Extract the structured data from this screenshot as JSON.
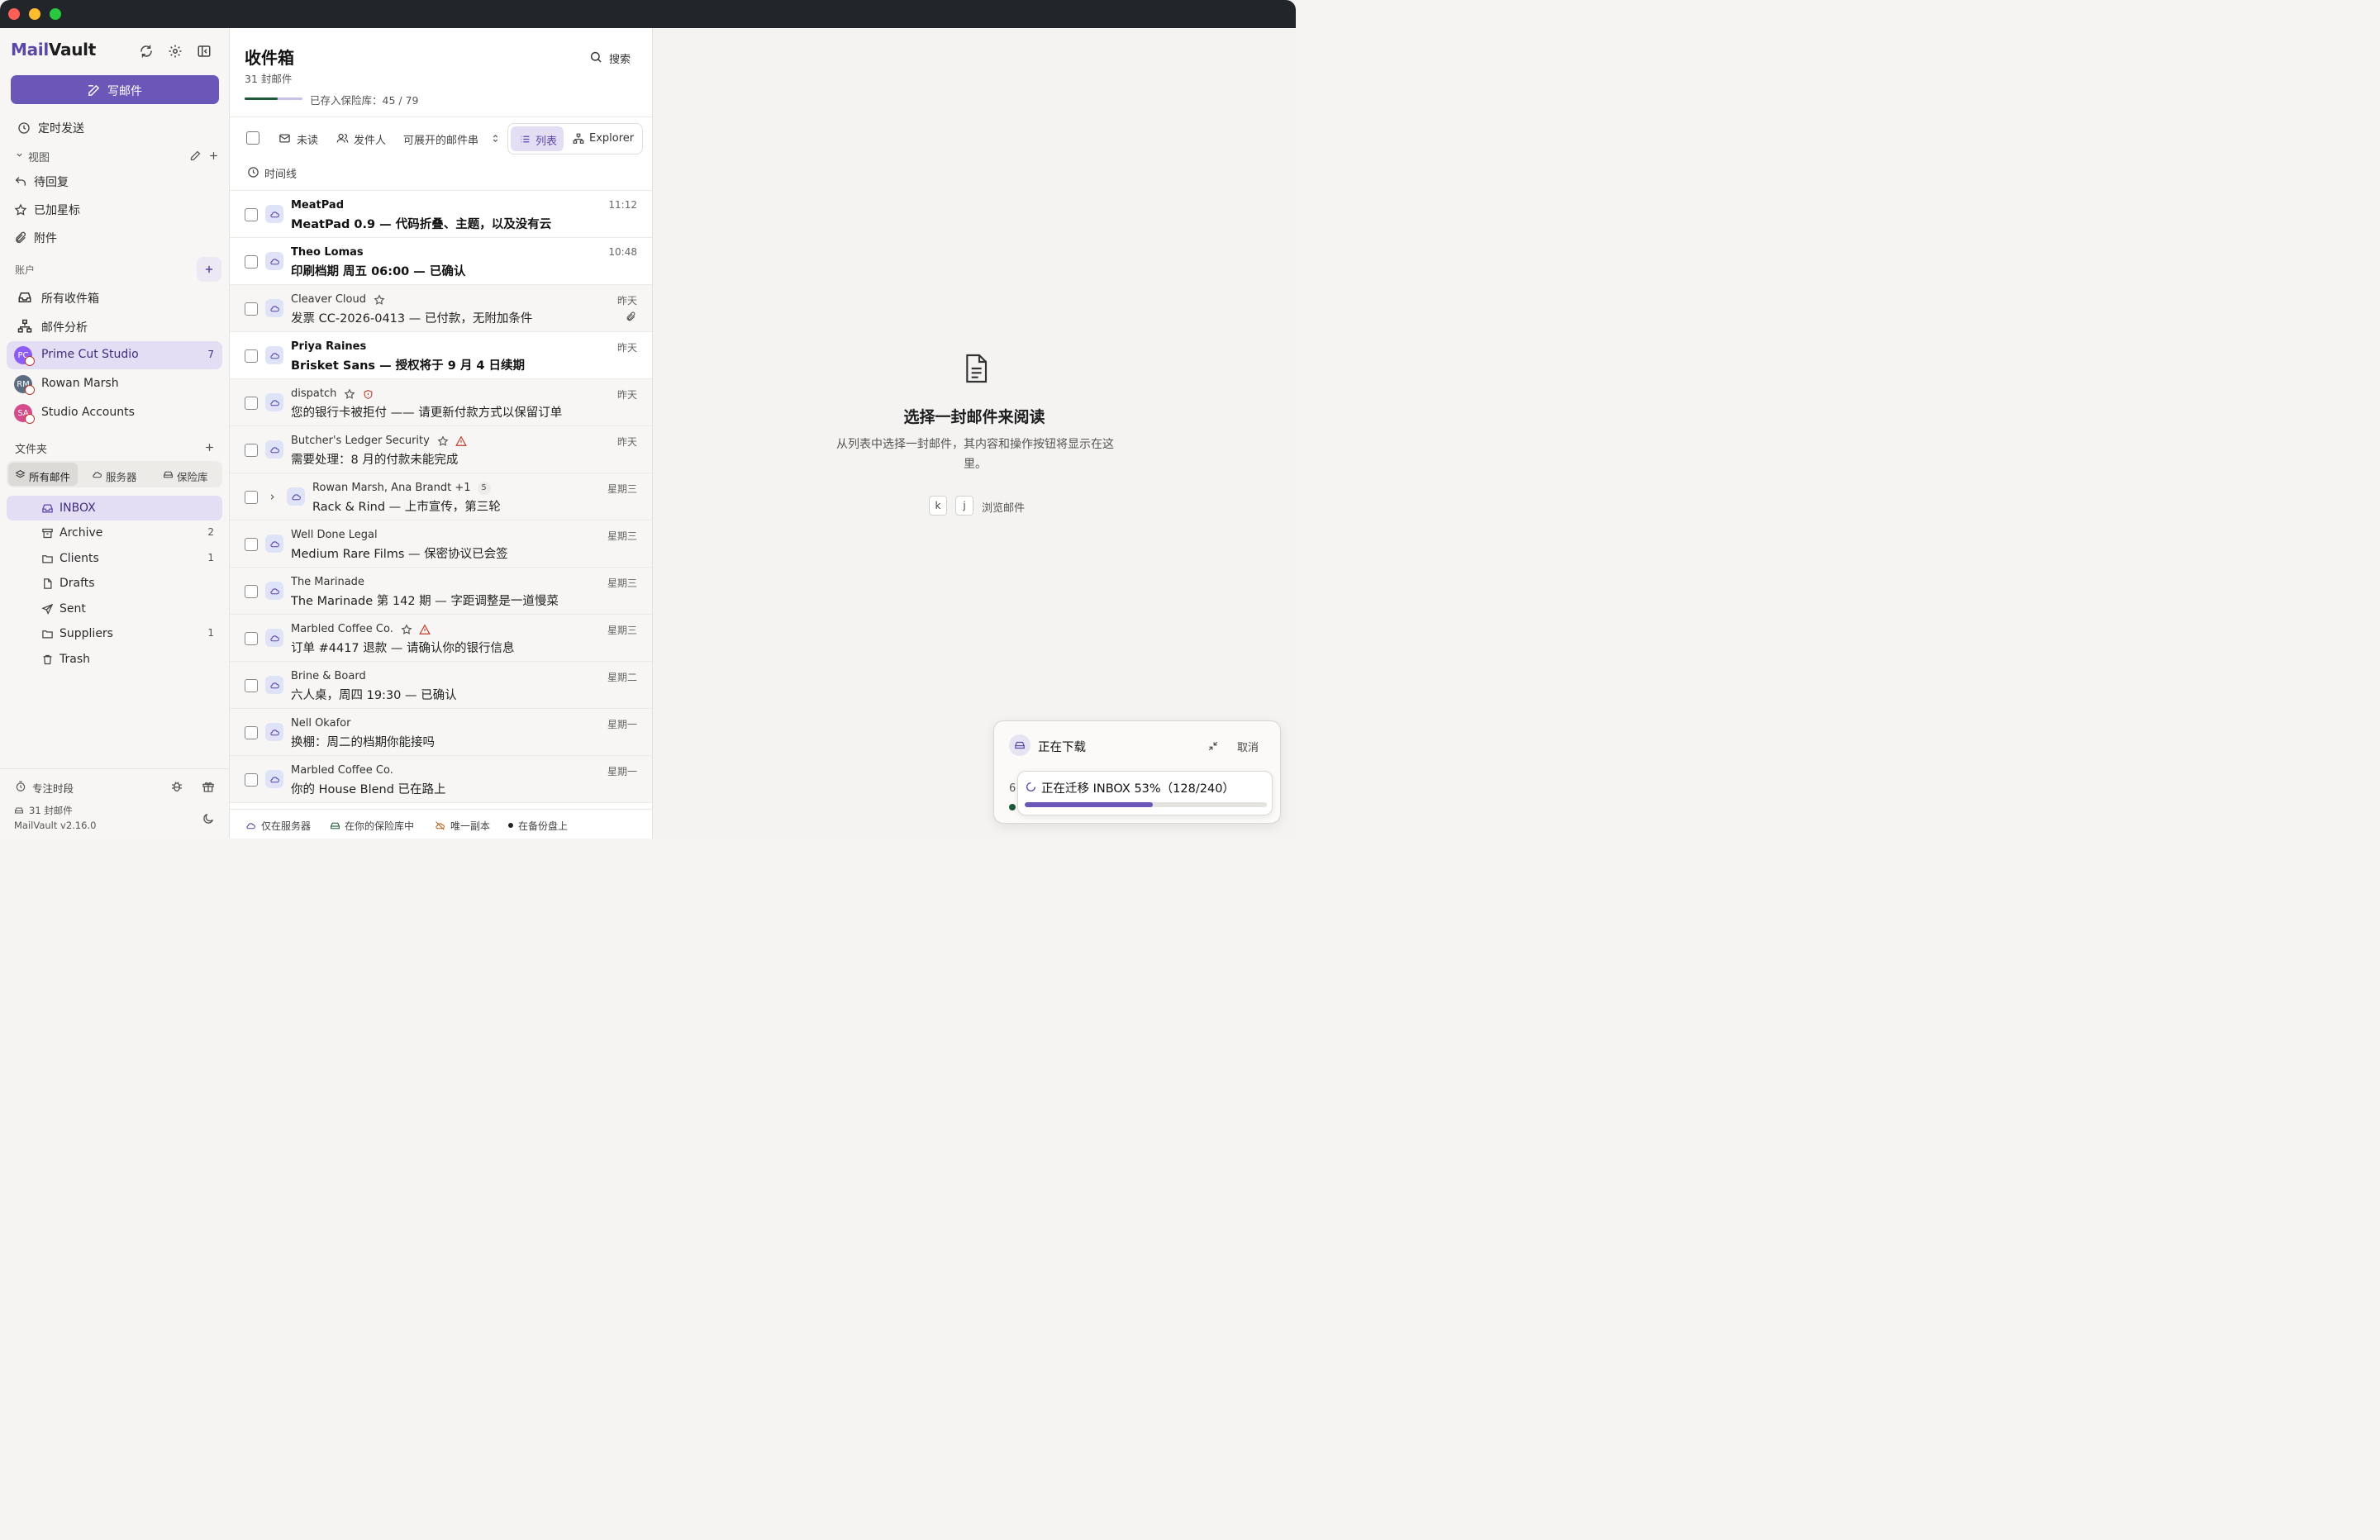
{
  "app": {
    "brand_prefix": "Mail",
    "brand_suffix": "Vault",
    "compose": "写邮件"
  },
  "sidebar": {
    "scheduled": "定时发送",
    "views_header": "视图",
    "views": [
      {
        "label": "待回复"
      },
      {
        "label": "已加星标"
      },
      {
        "label": "附件"
      }
    ],
    "accounts_header": "账户",
    "all_inboxes": "所有收件箱",
    "mail_analysis": "邮件分析",
    "accounts": [
      {
        "name": "Prime Cut Studio",
        "initials": "PC",
        "count": "7",
        "color": "#8b5cf6"
      },
      {
        "name": "Rowan Marsh",
        "initials": "RM",
        "count": "",
        "color": "#5b6b82"
      },
      {
        "name": "Studio Accounts",
        "initials": "SA",
        "count": "",
        "color": "#d64b8a"
      }
    ],
    "folders_header": "文件夹",
    "folder_tabs": [
      "所有邮件",
      "服务器",
      "保险库"
    ],
    "folders": [
      {
        "name": "INBOX",
        "count": ""
      },
      {
        "name": "Archive",
        "count": "2"
      },
      {
        "name": "Clients",
        "count": "1"
      },
      {
        "name": "Drafts",
        "count": ""
      },
      {
        "name": "Sent",
        "count": ""
      },
      {
        "name": "Suppliers",
        "count": "1"
      },
      {
        "name": "Trash",
        "count": ""
      }
    ],
    "focus": "专注时段",
    "mail_count": "31 封邮件",
    "version": "MailVault v2.16.0"
  },
  "list": {
    "title": "收件箱",
    "subtitle": "31 封邮件",
    "search": "搜索",
    "vault_label": "已存入保险库：45 / 79",
    "vault_progress": 0.57,
    "filters": {
      "unread": "未读",
      "sender": "发件人",
      "threads": "可展开的邮件串",
      "list": "列表",
      "explorer": "Explorer",
      "timeline": "时间线"
    },
    "messages": [
      {
        "sender": "MeatPad",
        "subject": "MeatPad 0.9 — 代码折叠、主题，以及没有云",
        "time": "11:12",
        "unread": true
      },
      {
        "sender": "Theo Lomas",
        "subject": "印刷档期 周五 06:00 — 已确认",
        "time": "10:48",
        "unread": true
      },
      {
        "sender": "Cleaver Cloud",
        "subject": "发票 CC-2026-0413 — 已付款，无附加条件",
        "time": "昨天",
        "unread": false,
        "star": true,
        "attach": true
      },
      {
        "sender": "Priya Raines",
        "subject": "Brisket Sans — 授权将于 9 月 4 日续期",
        "time": "昨天",
        "unread": true
      },
      {
        "sender": "dispatch",
        "subject": "您的银行卡被拒付 —— 请更新付款方式以保留订单",
        "time": "昨天",
        "unread": false,
        "star": true,
        "shield": true
      },
      {
        "sender": "Butcher's Ledger Security",
        "subject": "需要处理：8 月的付款未能完成",
        "time": "昨天",
        "unread": false,
        "star": true,
        "warn": true
      },
      {
        "sender": "Rowan Marsh, Ana Brandt +1",
        "subject": "Rack & Rind — 上市宣传，第三轮",
        "time": "星期三",
        "unread": false,
        "thread": "5"
      },
      {
        "sender": "Well Done Legal",
        "subject": "Medium Rare Films — 保密协议已会签",
        "time": "星期三",
        "unread": false
      },
      {
        "sender": "The Marinade",
        "subject": "The Marinade 第 142 期 — 字距调整是一道慢菜",
        "time": "星期三",
        "unread": false
      },
      {
        "sender": "Marbled Coffee Co.",
        "subject": "订单 #4417 退款 — 请确认你的银行信息",
        "time": "星期三",
        "unread": false,
        "star": true,
        "warn": true
      },
      {
        "sender": "Brine & Board",
        "subject": "六人桌，周四 19:30 — 已确认",
        "time": "星期二",
        "unread": false
      },
      {
        "sender": "Nell Okafor",
        "subject": "换棚：周二的档期你能接吗",
        "time": "星期一",
        "unread": false
      },
      {
        "sender": "Marbled Coffee Co.",
        "subject": "你的 House Blend 已在路上",
        "time": "星期一",
        "unread": false
      }
    ],
    "legend": [
      "仅在服务器",
      "在你的保险库中",
      "唯一副本",
      "在备份盘上"
    ]
  },
  "reader": {
    "empty_title": "选择一封邮件来阅读",
    "empty_desc": "从列表中选择一封邮件，其内容和操作按钮将显示在这里。",
    "key_k": "k",
    "key_j": "j",
    "key_hint": "浏览邮件"
  },
  "download": {
    "title": "正在下载",
    "cancel": "取消",
    "progress_label": "正在迁移 INBOX 53%（128/240）",
    "progress": 0.53,
    "behind_digit": "6"
  },
  "colors": {
    "accent": "#6b57b8",
    "accent_light": "#e4def5",
    "vault_green": "#1e5a3a"
  }
}
